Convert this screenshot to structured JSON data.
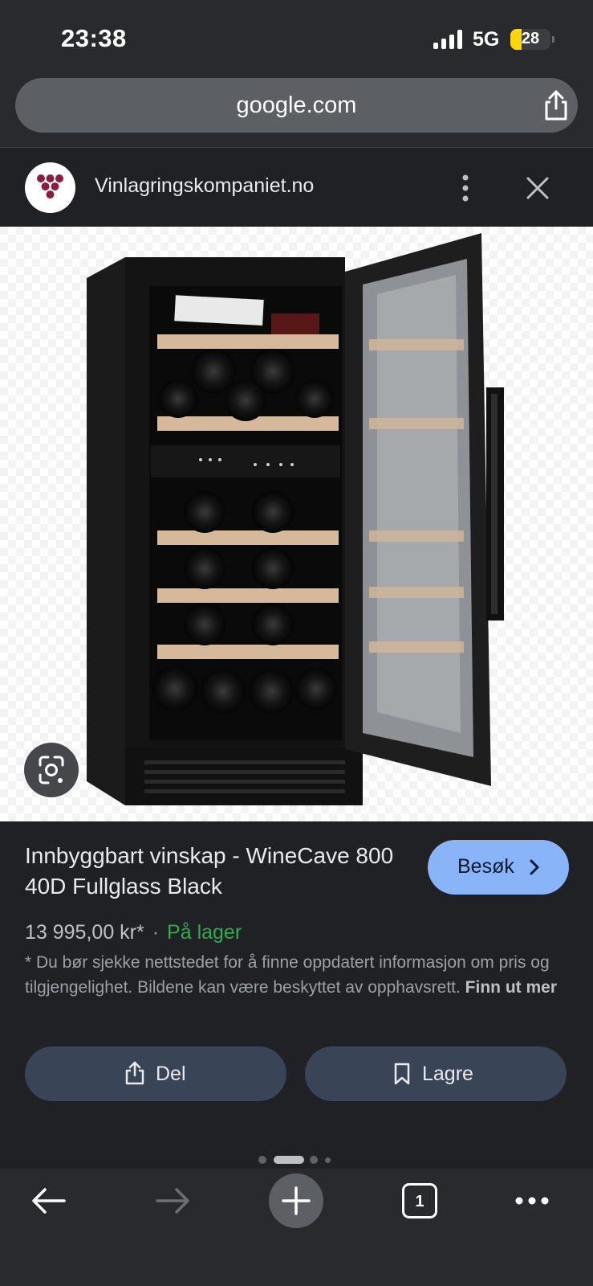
{
  "status_bar": {
    "time": "23:38",
    "network": "5G",
    "battery": "28",
    "battery_level": 0.28
  },
  "browser": {
    "url": "google.com",
    "share_icon": "share-icon"
  },
  "site": {
    "name": "Vinlagringskompaniet.no",
    "favicon": "grape-logo-icon",
    "more_icon": "more-vertical-icon",
    "close_icon": "close-icon"
  },
  "image": {
    "description_icon": "wine-cabinet-image",
    "lens_icon": "google-lens-icon"
  },
  "product": {
    "title": "Innbyggbart vinskap - WineCave 800 40D Fullglass Black",
    "visit_label": "Besøk",
    "price": "13 995,00 kr*",
    "separator": "·",
    "stock": "På lager",
    "disclaimer": "* Du bør sjekke nettstedet for å finne oppdatert informasjon om pris og tilgjengelighet. Bildene kan være beskyttet av opphavsrett.",
    "learn_more": "Finn ut mer",
    "share_label": "Del",
    "save_label": "Lagre"
  },
  "pager": {
    "count": 4,
    "active_index": 1
  },
  "bottom_nav": {
    "back_icon": "back-arrow-icon",
    "forward_icon": "forward-arrow-icon",
    "new_tab_icon": "plus-icon",
    "tab_count": "1",
    "menu_icon": "more-horizontal-icon"
  },
  "colors": {
    "accent": "#8ab4f8",
    "stock_green": "#34a853",
    "action_bg": "#394457",
    "background": "#202124"
  }
}
